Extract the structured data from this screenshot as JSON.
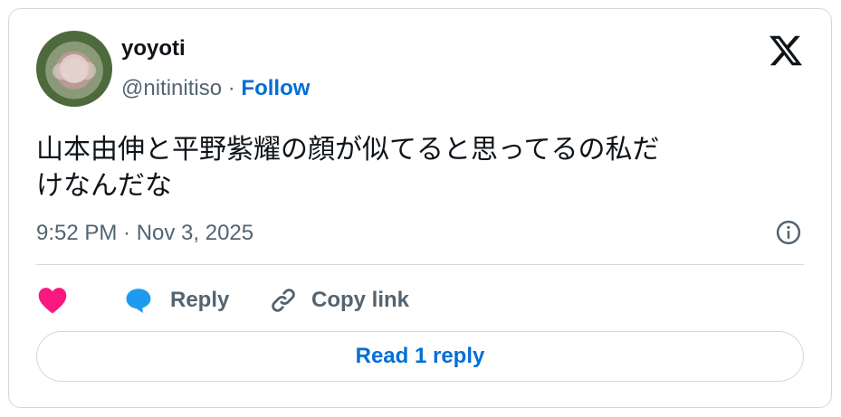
{
  "author": {
    "display_name": "yoyoti",
    "handle": "@nitinitiso",
    "separator": " · ",
    "follow_label": "Follow"
  },
  "tweet": {
    "text": "山本由伸と平野紫耀の顔が似てると思ってるの私だ\nけなんだな",
    "timestamp": "9:52 PM · Nov 3, 2025"
  },
  "actions": {
    "reply_label": "Reply",
    "copy_link_label": "Copy link"
  },
  "footer": {
    "read_replies_label": "Read 1 reply"
  },
  "icons": {
    "brand": "x-logo-icon",
    "info": "info-icon",
    "like": "heart-icon",
    "reply": "speech-bubble-icon",
    "copy": "link-icon"
  },
  "colors": {
    "text_primary": "#0f1419",
    "text_secondary": "#536471",
    "accent_blue": "#006fd6",
    "like_pink": "#f91880",
    "reply_blue": "#1d9bf0",
    "border": "#cfd9de"
  }
}
